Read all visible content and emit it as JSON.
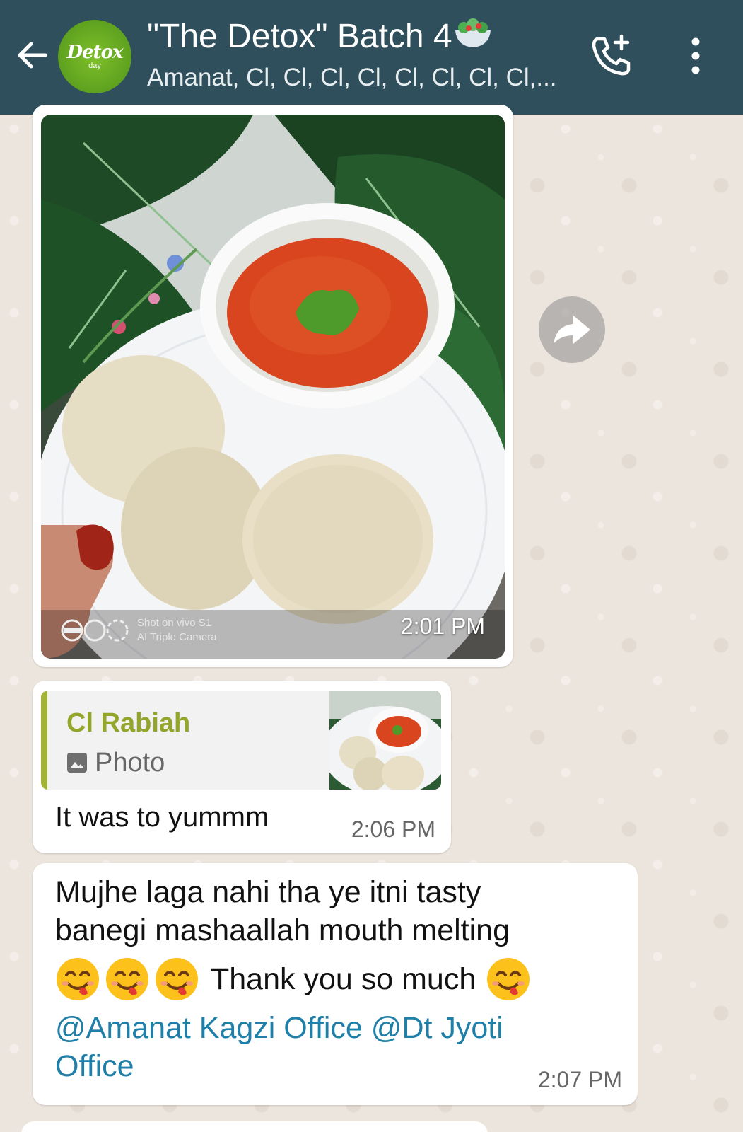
{
  "header": {
    "title": "\"The Detox\" Batch 4",
    "members": "Amanat, Cl, Cl, Cl, Cl, Cl, Cl, Cl, Cl,...",
    "avatar_logo": "Detox",
    "avatar_sub": "day",
    "icons": {
      "back": "arrow-left-icon",
      "call": "add-call-icon",
      "menu": "more-vert-icon",
      "title_emoji": "salad-icon"
    },
    "bar_color": "#2f4f5c"
  },
  "messages": {
    "photo": {
      "time": "2:01 PM",
      "watermark_line1": "Shot on vivo S1",
      "watermark_line2": "AI Triple Camera"
    },
    "reply": {
      "quoted_sender": "Cl Rabiah",
      "quoted_type": "Photo",
      "text": "It was to yummm",
      "time": "2:06 PM"
    },
    "text": {
      "line1": "Mujhe laga nahi tha ye itni tasty",
      "line2": "banegi mashaallah mouth melting",
      "thanks": "Thank you so much",
      "mention1": "@Amanat Kagzi Office",
      "mention2_a": "@Dt Jyoti",
      "mention2_b": "Office",
      "time": "2:07 PM"
    }
  },
  "colors": {
    "mention": "#1e7fa8",
    "quote_name": "#93a52a",
    "quote_bar": "#a3b335",
    "chat_bg": "#ece5dd"
  }
}
